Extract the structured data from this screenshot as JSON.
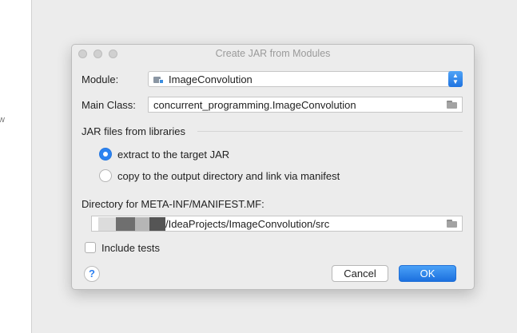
{
  "background": {
    "edge_text": "w"
  },
  "dialog": {
    "title": "Create JAR from Modules",
    "module": {
      "label": "Module:",
      "value": "ImageConvolution"
    },
    "main_class": {
      "label": "Main Class:",
      "value": "concurrent_programming.ImageConvolution"
    },
    "jar_section": {
      "heading": "JAR files from libraries",
      "options": [
        {
          "label": "extract to the target JAR",
          "selected": true
        },
        {
          "label": "copy to the output directory and link via manifest",
          "selected": false
        }
      ]
    },
    "manifest": {
      "label": "Directory for META-INF/MANIFEST.MF:",
      "value": "/IdeaProjects/ImageConvolution/src"
    },
    "include_tests": {
      "label": "Include tests",
      "checked": false
    },
    "help_glyph": "?",
    "buttons": {
      "cancel": "Cancel",
      "ok": "OK"
    }
  },
  "colors": {
    "accent": "#2c83f0",
    "window_bg": "#ececec"
  }
}
